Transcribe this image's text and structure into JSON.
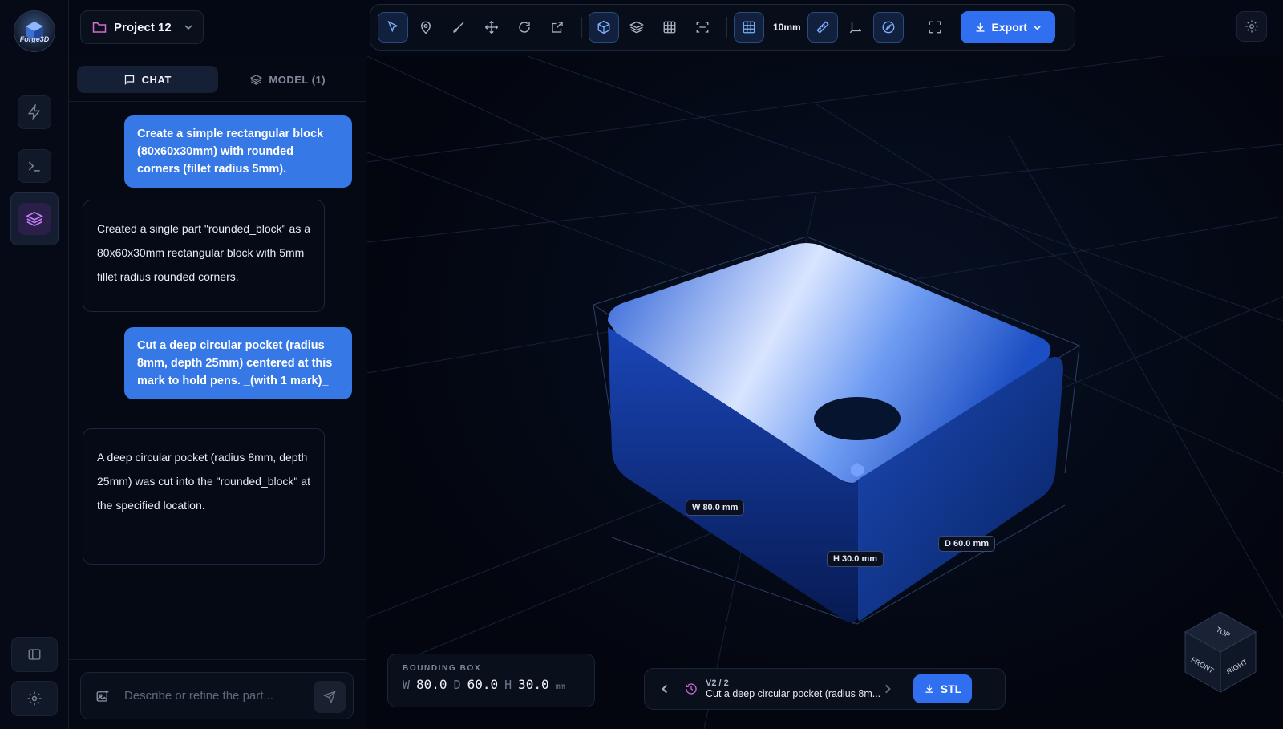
{
  "app": {
    "logo_text": "Forge3D"
  },
  "project": {
    "name": "Project 12"
  },
  "toolbar": {
    "grid_size": "10mm",
    "export_label": "Export"
  },
  "tabs": [
    {
      "label": "CHAT"
    },
    {
      "label": "MODEL (1)"
    }
  ],
  "messages": [
    {
      "role": "user",
      "text": "Create a simple rectangular block (80x60x30mm) with rounded corners (fillet radius 5mm)."
    },
    {
      "role": "assistant",
      "text": "Created a single part \"rounded_block\" as a 80x60x30mm rectangular block with 5mm fillet radius rounded corners."
    },
    {
      "role": "user",
      "text": "Cut a deep circular pocket (radius 8mm, depth 25mm) centered at this mark to hold pens. _(with 1 mark)_"
    },
    {
      "role": "assistant",
      "text": "A deep circular pocket (radius 8mm, depth 25mm) was cut into the \"rounded_block\" at the specified location."
    }
  ],
  "input": {
    "placeholder": "Describe or refine the part..."
  },
  "dimensions": {
    "w": "W 80.0 mm",
    "h": "H 30.0 mm",
    "d": "D 60.0 mm"
  },
  "bounding_box": {
    "title": "BOUNDING BOX",
    "w_key": "W",
    "w": "80.0",
    "d_key": "D",
    "d": "60.0",
    "h_key": "H",
    "h": "30.0",
    "unit": "mm"
  },
  "version": {
    "label": "V2 / 2",
    "description": "Cut a deep circular pocket (radius 8m...",
    "download_label": "STL"
  },
  "view_cube": {
    "top": "TOP",
    "front": "FRONT",
    "right": "RIGHT"
  },
  "colors": {
    "accent": "#2f6ff0",
    "user_bubble": "#3678e6",
    "highlight": "#c47cf5"
  }
}
